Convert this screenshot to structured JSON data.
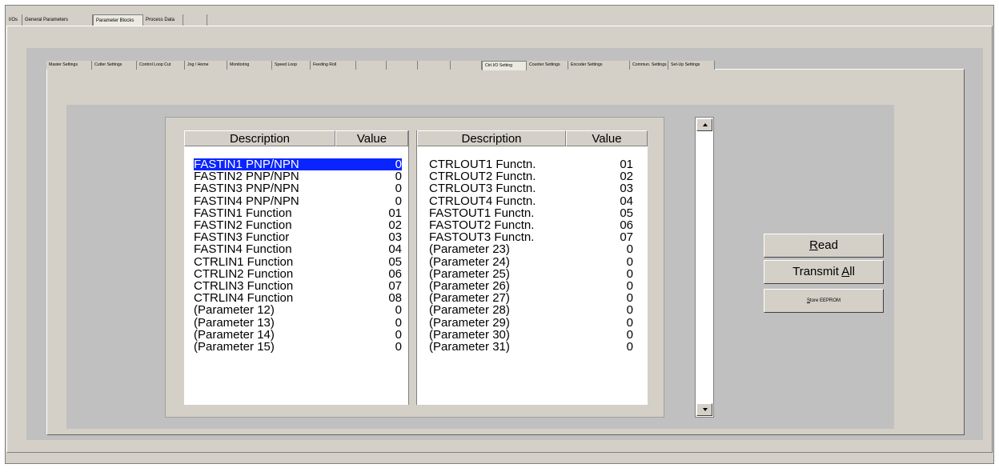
{
  "top_tabs": [
    {
      "label": "I/Os",
      "selected": false
    },
    {
      "label": "General Parameters",
      "selected": false
    },
    {
      "label": "Parameter Blocks",
      "selected": true
    },
    {
      "label": "Process Data",
      "selected": false
    },
    {
      "label": "",
      "selected": false
    }
  ],
  "inner_tabs": [
    {
      "label": "Master Settings",
      "selected": false
    },
    {
      "label": "Cutter Settings",
      "selected": false
    },
    {
      "label": "Control Loop Cut",
      "selected": false
    },
    {
      "label": "Jog / Home",
      "selected": false
    },
    {
      "label": "Monitoring",
      "selected": false
    },
    {
      "label": "Speed Loop",
      "selected": false
    },
    {
      "label": "Feeding Roll",
      "selected": false
    },
    {
      "label": "",
      "selected": false
    },
    {
      "label": "",
      "selected": false
    },
    {
      "label": "",
      "selected": false
    },
    {
      "label": "",
      "selected": false
    },
    {
      "label": "Ctrl.I/O Setting",
      "selected": true
    },
    {
      "label": "Counter Settings",
      "selected": false
    },
    {
      "label": "Encoder Settings",
      "selected": false
    },
    {
      "label": "Commun. Settings",
      "selected": false
    },
    {
      "label": "Set-Up Settings",
      "selected": false
    }
  ],
  "left_list": {
    "header_description": "Description",
    "header_value": "Value",
    "rows": [
      {
        "description": "FASTIN1 PNP/NPN",
        "value": "0",
        "selected": true
      },
      {
        "description": "FASTIN2 PNP/NPN",
        "value": "0"
      },
      {
        "description": "FASTIN3 PNP/NPN",
        "value": "0"
      },
      {
        "description": "FASTIN4 PNP/NPN",
        "value": "0"
      },
      {
        "description": "FASTIN1 Function",
        "value": "01"
      },
      {
        "description": "FASTIN2 Function",
        "value": "02"
      },
      {
        "description": "FASTIN3 Functior",
        "value": "03"
      },
      {
        "description": "FASTIN4 Function",
        "value": "04"
      },
      {
        "description": "CTRLIN1 Function",
        "value": "05"
      },
      {
        "description": "CTRLIN2 Function",
        "value": "06"
      },
      {
        "description": "CTRLIN3 Function",
        "value": "07"
      },
      {
        "description": "CTRLIN4 Function",
        "value": "08"
      },
      {
        "description": "(Parameter 12)",
        "value": "0"
      },
      {
        "description": "(Parameter 13)",
        "value": "0"
      },
      {
        "description": "(Parameter 14)",
        "value": "0"
      },
      {
        "description": "(Parameter 15)",
        "value": "0"
      }
    ]
  },
  "right_list": {
    "header_description": "Description",
    "header_value": "Value",
    "rows": [
      {
        "description": "CTRLOUT1 Functn.",
        "value": "01"
      },
      {
        "description": "CTRLOUT2 Functn.",
        "value": "02"
      },
      {
        "description": "CTRLOUT3 Functn.",
        "value": "03"
      },
      {
        "description": "CTRLOUT4 Functn.",
        "value": "04"
      },
      {
        "description": "FASTOUT1 Functn.",
        "value": "05"
      },
      {
        "description": "FASTOUT2 Functn.",
        "value": "06"
      },
      {
        "description": "FASTOUT3 Functn.",
        "value": "07"
      },
      {
        "description": "(Parameter 23)",
        "value": "0"
      },
      {
        "description": "(Parameter 24)",
        "value": "0"
      },
      {
        "description": "(Parameter 25)",
        "value": "0"
      },
      {
        "description": "(Parameter 26)",
        "value": "0"
      },
      {
        "description": "(Parameter 27)",
        "value": "0"
      },
      {
        "description": "(Parameter 28)",
        "value": "0"
      },
      {
        "description": "(Parameter 29)",
        "value": "0"
      },
      {
        "description": "(Parameter 30)",
        "value": "0"
      },
      {
        "description": "(Parameter 31)",
        "value": "0"
      }
    ]
  },
  "buttons": {
    "read_prefix": "",
    "read_mnemonic": "R",
    "read_suffix": "ead",
    "transmit_prefix": "Transmit ",
    "transmit_mnemonic": "A",
    "transmit_suffix": "ll",
    "store_mnemonic": "S",
    "store_suffix": "tore EEPROM"
  },
  "icons": {
    "scroll_up": "triangle-up-icon",
    "scroll_down": "triangle-down-icon"
  },
  "colors": {
    "selection": "#0a24ff",
    "window_face": "#d4d0c8",
    "frame_gray": "#c0c0c0"
  }
}
